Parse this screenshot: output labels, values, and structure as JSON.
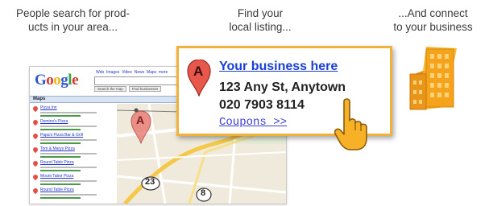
{
  "captions": [
    "People search for prod-\nucts in your area...",
    "Find your\nlocal listing...",
    "...And connect\nto your business"
  ],
  "serp": {
    "logo": "Google",
    "maps_label": "Maps",
    "buttons": [
      "Search the map",
      "Find businesses"
    ],
    "results": [
      {
        "title": "Pizza Inn"
      },
      {
        "title": "Domino's Pizza"
      },
      {
        "title": "Papa's Pizza Bar & Grill"
      },
      {
        "title": "Tom & Marys Pizza"
      },
      {
        "title": "Round Table Pizza"
      },
      {
        "title": "Mount Tabor Pizza"
      },
      {
        "title": "Round Table Pizza"
      }
    ],
    "map_labels": [
      "23",
      "8"
    ]
  },
  "card": {
    "pin_letter": "A",
    "business_name": "Your business here",
    "address": "123 Any St, Anytown",
    "phone": "020 7903 8114",
    "coupons": "Coupons >>"
  },
  "map_pin_letter": "A",
  "colors": {
    "card_border": "#f0b23a",
    "link_blue": "#1a3fd8",
    "pin_red": "#e25046",
    "building_orange": "#f4a31a"
  },
  "icons": {
    "pointer": "hand-pointer-icon",
    "building": "building-icon",
    "map_marker": "map-marker-icon"
  }
}
